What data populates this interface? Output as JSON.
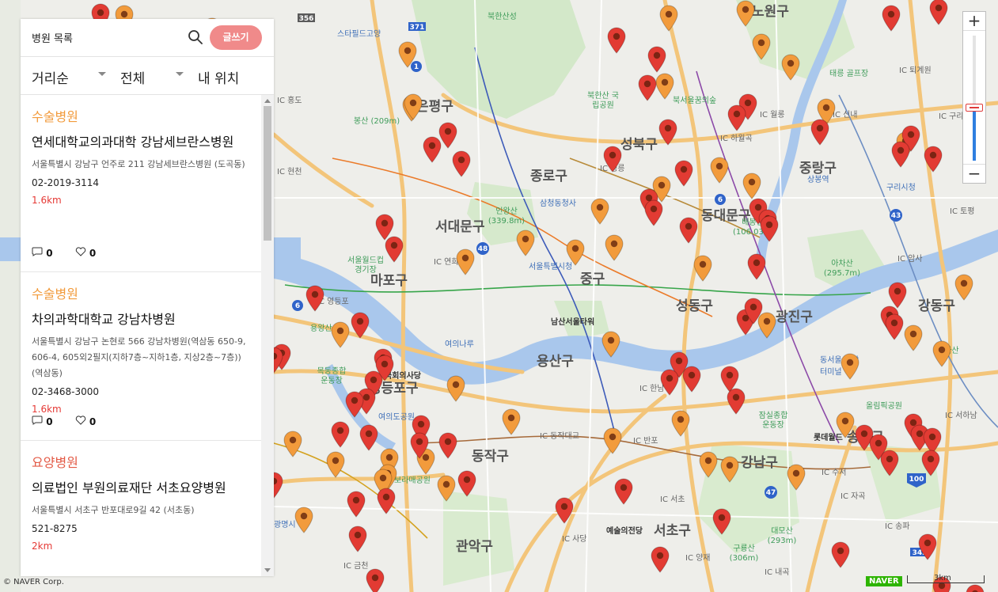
{
  "panel": {
    "title": "병원 목록",
    "write_label": "글쓰기",
    "filters": {
      "sort": "거리순",
      "category": "전체",
      "location": "내 위치"
    },
    "items": [
      {
        "category": "수술병원",
        "name": "연세대학교의과대학 강남세브란스병원",
        "address": "서울특별시 강남구 언주로 211 강남세브란스병원 (도곡동)",
        "phone": "02-2019-3114",
        "distance": "1.6km",
        "comments": "0",
        "likes": "0"
      },
      {
        "category": "수술병원",
        "name": "차의과학대학교 강남차병원",
        "address": "서울특별시 강남구 논현로 566 강남차병원(역삼동 650-9, 606-4, 605외2필지(지하7층~지하1층, 지상2층~7층)) (역삼동)",
        "phone": "02-3468-3000",
        "distance": "1.6km",
        "comments": "0",
        "likes": "0"
      },
      {
        "category": "요양병원",
        "name": "의료법인 부원의료재단 서초요양병원",
        "address": "서울특별시 서초구 반포대로9길 42 (서초동)",
        "phone": "521-8275",
        "distance": "2km",
        "comments": "0",
        "likes": "0"
      }
    ]
  },
  "map": {
    "district_labels": [
      "종로구",
      "서대문구",
      "마포구",
      "중구",
      "용산구",
      "성동구",
      "동대문구",
      "성북구",
      "강동구",
      "동작구",
      "서초구",
      "관악구",
      "영등포구",
      "중랑구",
      "광진구",
      "송파구",
      "강남구",
      "은평구",
      "노원구"
    ],
    "park_labels": [
      "북한산성",
      "북한산 국립공원",
      "북서울꿈의숲",
      "봉산 (209m)",
      "인왕산 (339.8m)",
      "배봉산 (106.03m)",
      "아차산 (295.7m)",
      "서울월드컵 경기장",
      "남산서울타워",
      "보라매공원",
      "대모산 (293m)",
      "구룡산 (306m)",
      "올림픽공원",
      "태릉 골프장",
      "일자산",
      "목동종합 운동장",
      "잠실종합 운동장",
      "용왕산",
      "스타필드고양"
    ],
    "place_labels": [
      "국회의사당",
      "예술의전당",
      "롯데월드",
      "삼청동청사",
      "서울특별시청",
      "구리시청",
      "동서울 종합터미널",
      "상봉역",
      "여의도공원",
      "여의나루",
      "광명시"
    ],
    "road_badges": [
      "1",
      "371",
      "356",
      "6",
      "48",
      "100",
      "43",
      "47",
      "342",
      "6"
    ],
    "ic_labels": [
      "IC 홍도",
      "IC 현천",
      "IC 연희",
      "IC 영등포",
      "IC 반포",
      "IC 한남",
      "IC 동작대교",
      "IC 서초",
      "IC 양재",
      "IC 사당",
      "IC 금천",
      "IC 내곡",
      "IC 수서",
      "IC 자곡",
      "IC 송파",
      "IC 서하남",
      "IC 토평",
      "IC 암사",
      "IC 퇴계원",
      "IC 구리",
      "IC 신내",
      "IC 월롱",
      "IC 하월곡",
      "IC 정릉"
    ],
    "pin_colors": {
      "surgery": "#f29b3c",
      "nursing": "#e23b33"
    },
    "pin_counts": {
      "orange": 52,
      "red": 90
    }
  },
  "zoom": {
    "in_label": "+",
    "out_label": "−",
    "level": 0.55
  },
  "footer": {
    "copyright": "© NAVER Corp.",
    "logo": "NAVER",
    "scale": "3km"
  }
}
